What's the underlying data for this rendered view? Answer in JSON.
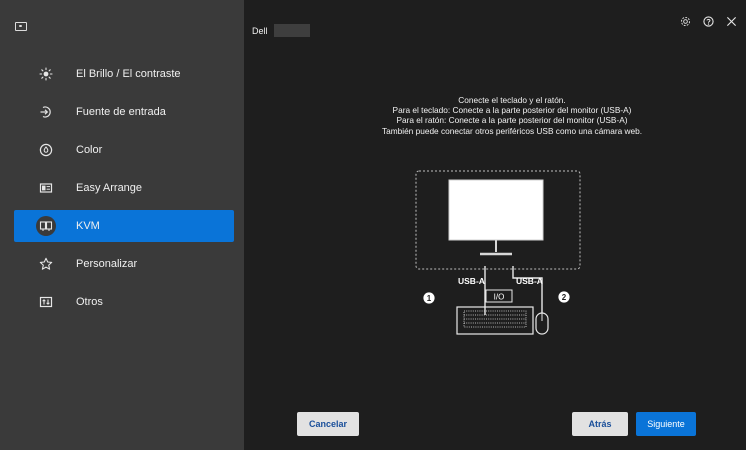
{
  "header": {
    "brand": "Dell",
    "icons": [
      "gear-icon",
      "help-icon",
      "close-icon"
    ]
  },
  "sidebar": {
    "items": [
      {
        "label": "El Brillo / El contraste",
        "icon": "brightness-icon",
        "active": false
      },
      {
        "label": "Fuente de entrada",
        "icon": "input-source-icon",
        "active": false
      },
      {
        "label": "Color",
        "icon": "color-icon",
        "active": false
      },
      {
        "label": "Easy Arrange",
        "icon": "easy-arrange-icon",
        "active": false
      },
      {
        "label": "KVM",
        "icon": "kvm-icon",
        "active": true
      },
      {
        "label": "Personalizar",
        "icon": "star-icon",
        "active": false
      },
      {
        "label": "Otros",
        "icon": "others-icon",
        "active": false
      }
    ]
  },
  "content": {
    "line1": "Conecte el teclado y el ratón.",
    "line2": "Para el teclado: Conecte a la parte posterior del monitor (USB-A)",
    "line3": "Para el ratón:  Conecte a la parte posterior del monitor (USB-A)",
    "line4": "También puede conectar otros periféricos USB como una cámara web."
  },
  "diagram": {
    "port_left_label": "USB-A",
    "port_right_label": "USB-A",
    "io_label": "I/O",
    "marker_1": "1",
    "marker_2": "2"
  },
  "buttons": {
    "cancel": "Cancelar",
    "back": "Atrás",
    "next": "Siguiente"
  },
  "colors": {
    "accent": "#0a74d8",
    "sidebar_bg": "#3a3a3a",
    "main_bg": "#1e1e1e"
  }
}
